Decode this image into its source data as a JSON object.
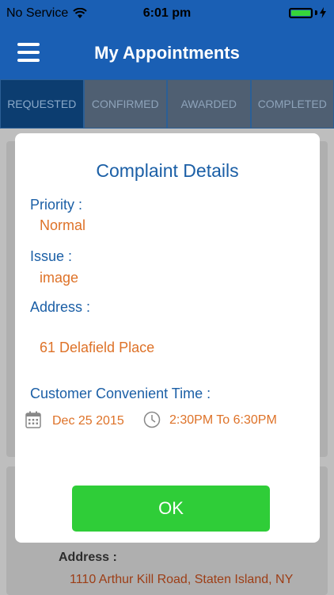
{
  "status_bar": {
    "carrier": "No Service",
    "time": "6:01 pm",
    "battery_color": "#37d43a"
  },
  "nav": {
    "title": "My Appointments",
    "menu_icon": "hamburger-icon"
  },
  "tabs": [
    {
      "label": "REQUESTED",
      "active": true
    },
    {
      "label": "CONFIRMED",
      "active": false
    },
    {
      "label": "AWARDED",
      "active": false
    },
    {
      "label": "COMPLETED",
      "active": false
    }
  ],
  "background_card": {
    "address_label": "Address :",
    "address_value": "1110 Arthur Kill Road, Staten Island, NY"
  },
  "dialog": {
    "title": "Complaint Details",
    "priority_label": "Priority  :",
    "priority_value": "Normal",
    "issue_label": "Issue :",
    "issue_value": "image",
    "address_label": "Address :",
    "address_value": "61 Delafield Place",
    "time_label": "Customer Convenient Time :",
    "date_value": "Dec 25 2015",
    "time_value": "2:30PM To 6:30PM",
    "ok_label": "OK"
  },
  "colors": {
    "primary_blue": "#1a5fb4",
    "label_blue": "#1b5fa6",
    "value_orange": "#de7228",
    "ok_green": "#2fcd38"
  }
}
